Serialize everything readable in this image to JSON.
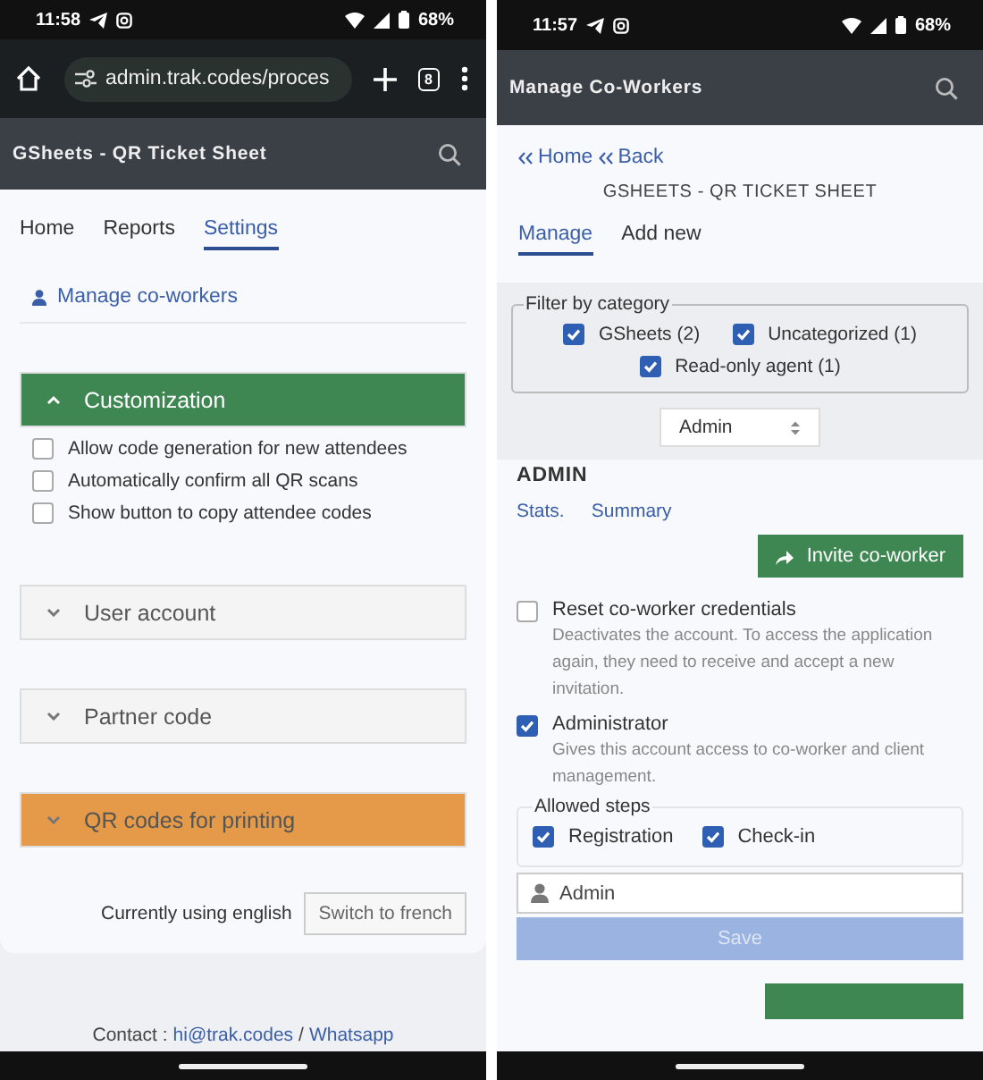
{
  "left_phone": {
    "status_bar": {
      "time": "11:58",
      "battery": "68%"
    },
    "browser": {
      "url": "admin.trak.codes/proces",
      "tab_count": "8"
    },
    "app_bar": {
      "title": "GSheets - QR Ticket Sheet"
    },
    "tabs": [
      {
        "label": "Home",
        "selected": false
      },
      {
        "label": "Reports",
        "selected": false
      },
      {
        "label": "Settings",
        "selected": true
      }
    ],
    "manage_link": "Manage co-workers",
    "sections": [
      {
        "title": "Customization",
        "expanded": true,
        "color": "#3e8752",
        "options": [
          {
            "label": "Allow code generation for new attendees",
            "checked": false
          },
          {
            "label": "Automatically confirm all QR scans",
            "checked": false
          },
          {
            "label": "Show button to copy attendee codes",
            "checked": false
          }
        ]
      },
      {
        "title": "User account",
        "expanded": false,
        "color": "#f4f4f4"
      },
      {
        "title": "Partner code",
        "expanded": false,
        "color": "#f4f4f4"
      },
      {
        "title": "QR codes for printing",
        "expanded": false,
        "color": "#e49a48"
      }
    ],
    "language": {
      "status": "Currently using english",
      "button": "Switch to french"
    },
    "footer": {
      "prefix": "Contact :",
      "email": "hi@trak.codes",
      "separator": "/",
      "whatsapp": "Whatsapp"
    }
  },
  "right_phone": {
    "status_bar": {
      "time": "11:57",
      "battery": "68%"
    },
    "app_bar": {
      "title": "Manage Co-Workers"
    },
    "breadcrumb": [
      "Home",
      "Back"
    ],
    "subtitle": "GSHEETS - QR TICKET SHEET",
    "tabs": [
      {
        "label": "Manage",
        "selected": true
      },
      {
        "label": "Add new",
        "selected": false
      }
    ],
    "filter": {
      "legend": "Filter by category",
      "options": [
        {
          "label": "GSheets (2)",
          "checked": true
        },
        {
          "label": "Uncategorized (1)",
          "checked": true
        },
        {
          "label": "Read-only agent (1)",
          "checked": true
        }
      ]
    },
    "role_select": "Admin",
    "group_title": "ADMIN",
    "links": [
      "Stats.",
      "Summary"
    ],
    "invite_button": "Invite co-worker",
    "settings": [
      {
        "label": "Reset co-worker credentials",
        "description": "Deactivates the account. To access the application again, they need to receive and accept a new invitation.",
        "checked": false
      },
      {
        "label": "Administrator",
        "description": "Gives this account access to co-worker and client management.",
        "checked": true
      }
    ],
    "steps": {
      "legend": "Allowed steps",
      "options": [
        {
          "label": "Registration",
          "checked": true
        },
        {
          "label": "Check-in",
          "checked": true
        }
      ]
    },
    "name_field": "Admin",
    "save_button": {
      "label": "Save",
      "disabled": true
    }
  }
}
